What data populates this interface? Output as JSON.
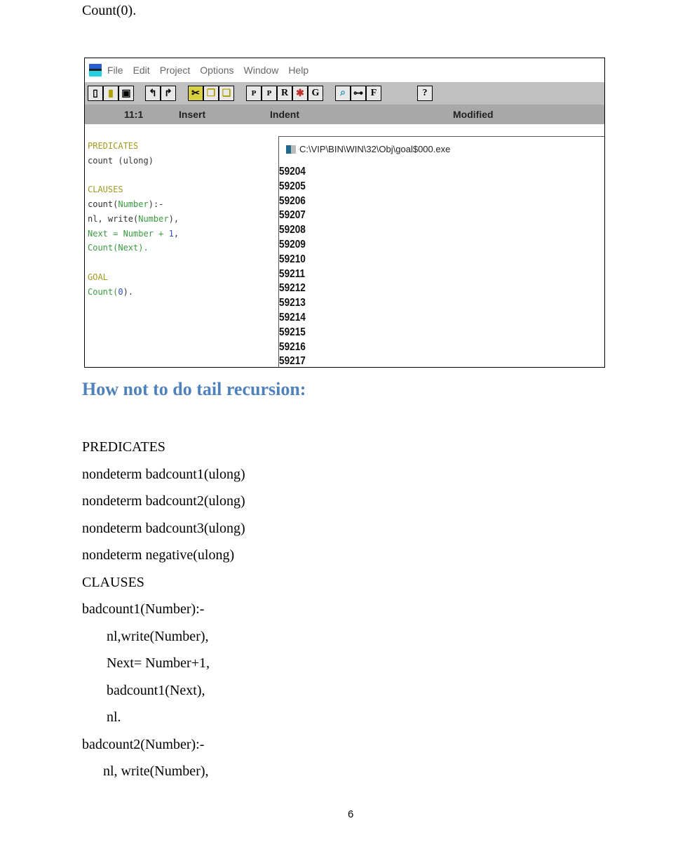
{
  "intro_line": "Count(0).",
  "screenshot": {
    "menu": [
      "File",
      "Edit",
      "Project",
      "Options",
      "Window",
      "Help"
    ],
    "toolbar_icons": [
      "new-file",
      "open-file",
      "save",
      "undo",
      "redo",
      "cut",
      "copy",
      "paste",
      "P",
      "P2",
      "R",
      "debug-bug",
      "G",
      "browse",
      "tree",
      "F",
      "help"
    ],
    "status": {
      "position": "11:1",
      "mode": "Insert",
      "indent": "Indent",
      "modified": "Modified"
    },
    "code": {
      "predicates_kw": "PREDICATES",
      "pred_line": "count (ulong)",
      "clauses_kw": "CLAUSES",
      "l1a": "count(",
      "l1b": "Number",
      "l1c": "):-",
      "l2a": "nl, write(",
      "l2b": "Number",
      "l2c": "),",
      "l3a": "Next = Number + ",
      "l3b": "1",
      "l3c": ",",
      "l4a": "Count(Next).",
      "goal_kw": "GOAL",
      "l5a": "Count(",
      "l5b": "0",
      "l5c": ")."
    },
    "console": {
      "title": "C:\\VIP\\BIN\\WIN\\32\\Obj\\goal$000.exe",
      "output": [
        "59204",
        "59205",
        "59206",
        "59207",
        "59208",
        "59209",
        "59210",
        "59211",
        "59212",
        "59213",
        "59214",
        "59215",
        "59216",
        "59217"
      ]
    }
  },
  "heading": "How not to do tail recursion:",
  "body_lines": [
    "PREDICATES",
    "nondeterm badcount1(ulong)",
    "nondeterm badcount2(ulong)",
    "nondeterm badcount3(ulong)",
    "nondeterm negative(ulong)",
    "CLAUSES",
    "badcount1(Number):-",
    "       nl,write(Number),",
    "       Next= Number+1,",
    "       badcount1(Next),",
    "       nl.",
    "badcount2(Number):-",
    "      nl, write(Number),"
  ],
  "page_number": "6"
}
